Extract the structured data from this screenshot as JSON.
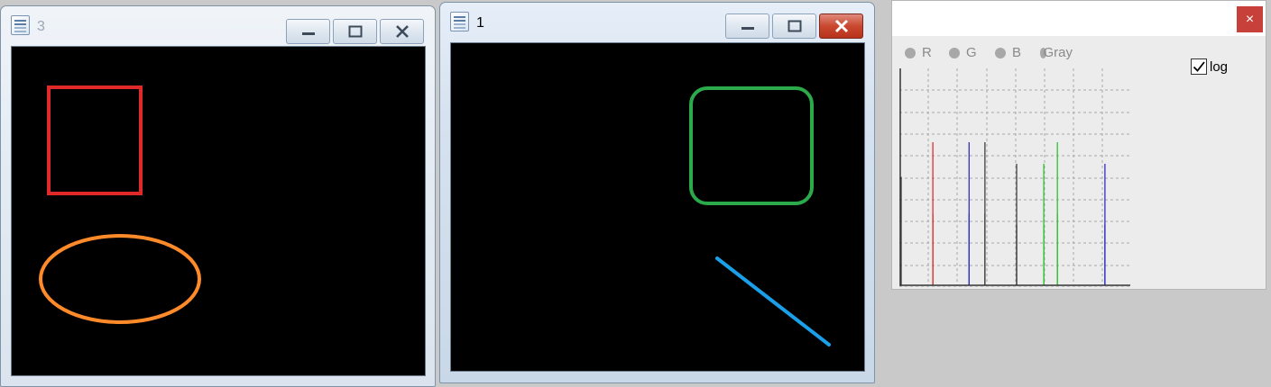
{
  "windows": {
    "win3": {
      "title": "3",
      "icon": "document-icon",
      "controls": [
        "minimize-icon",
        "maximize-icon",
        "close-icon"
      ]
    },
    "win1": {
      "title": "1",
      "icon": "document-icon",
      "controls": [
        "minimize-icon",
        "maximize-icon",
        "close-icon"
      ],
      "close_active_color": "#c9482f"
    }
  },
  "shapes": {
    "win3": [
      {
        "kind": "rectangle",
        "color": "#e02a2a"
      },
      {
        "kind": "ellipse",
        "color": "#ff8a2a"
      }
    ],
    "win1": [
      {
        "kind": "rounded-rectangle",
        "color": "#2aaa4a"
      },
      {
        "kind": "line",
        "color": "#1aa0e8"
      }
    ]
  },
  "histogram_panel": {
    "close_label": "×",
    "channels": [
      {
        "label": "R"
      },
      {
        "label": "G"
      },
      {
        "label": "B"
      },
      {
        "label": "Gray"
      }
    ],
    "log_label": "log",
    "log_checked": true
  },
  "chart_data": {
    "type": "bar",
    "grid": true,
    "series": [
      {
        "color": "#e03030",
        "values": [
          {
            "x": 0.14,
            "y": 0.66
          },
          {
            "x": 0.14,
            "y": 0.33
          }
        ]
      },
      {
        "color": "#3030c0",
        "values": [
          {
            "x": 0.3,
            "y": 0.66
          },
          {
            "x": 0.3,
            "y": 0.33
          },
          {
            "x": 0.9,
            "y": 0.56
          },
          {
            "x": 0.9,
            "y": 0.28
          }
        ]
      },
      {
        "color": "#404040",
        "values": [
          {
            "x": 0.37,
            "y": 0.66
          },
          {
            "x": 0.37,
            "y": 0.33
          },
          {
            "x": 0.51,
            "y": 0.56
          },
          {
            "x": 0.51,
            "y": 0.28
          },
          {
            "x": 0.0,
            "y": 0.5
          }
        ]
      },
      {
        "color": "#30c030",
        "values": [
          {
            "x": 0.63,
            "y": 0.56
          },
          {
            "x": 0.63,
            "y": 0.28
          },
          {
            "x": 0.69,
            "y": 0.66
          },
          {
            "x": 0.69,
            "y": 0.33
          }
        ]
      }
    ]
  }
}
